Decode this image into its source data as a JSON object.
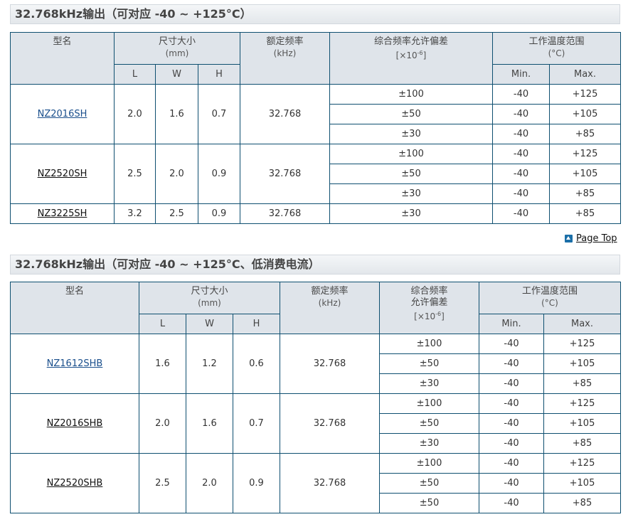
{
  "section1": {
    "title": "32.768kHz输出（可对应 -40 ~ +125°C）",
    "headers": {
      "model": "型名",
      "size": "尺寸大小",
      "size_unit": "(mm)",
      "L": "L",
      "W": "W",
      "H": "H",
      "freq": "额定频率",
      "freq_unit": "(kHz)",
      "tolerance": "综合频率允许偏差",
      "tol_unit_prefix": "[×10",
      "tol_unit_exp": "-6",
      "tol_unit_suffix": "]",
      "temp": "工作温度范围",
      "temp_unit": "(°C)",
      "min": "Min.",
      "max": "Max."
    },
    "groups": [
      {
        "model": "NZ2016SH",
        "linked": true,
        "L": "2.0",
        "W": "1.6",
        "H": "0.7",
        "freq": "32.768",
        "rows": [
          {
            "tol": "±100",
            "min": "-40",
            "max": "+125"
          },
          {
            "tol": "±50",
            "min": "-40",
            "max": "+105"
          },
          {
            "tol": "±30",
            "min": "-40",
            "max": "+85"
          }
        ]
      },
      {
        "model": "NZ2520SH",
        "linked": false,
        "L": "2.5",
        "W": "2.0",
        "H": "0.9",
        "freq": "32.768",
        "rows": [
          {
            "tol": "±100",
            "min": "-40",
            "max": "+125"
          },
          {
            "tol": "±50",
            "min": "-40",
            "max": "+105"
          },
          {
            "tol": "±30",
            "min": "-40",
            "max": "+85"
          }
        ]
      },
      {
        "model": "NZ3225SH",
        "linked": false,
        "L": "3.2",
        "W": "2.5",
        "H": "0.9",
        "freq": "32.768",
        "rows": [
          {
            "tol": "±30",
            "min": "-40",
            "max": "+85"
          }
        ]
      }
    ]
  },
  "page_top": "Page Top",
  "section2": {
    "title": "32.768kHz输出（可对应 -40 ~ +125°C、低消费电流）",
    "headers": {
      "model": "型名",
      "size": "尺寸大小",
      "size_unit": "(mm)",
      "L": "L",
      "W": "W",
      "H": "H",
      "freq": "额定频率",
      "freq_unit": "(kHz)",
      "tolerance_line1": "综合频率",
      "tolerance_line2": "允许偏差",
      "tol_unit_prefix": "[×10",
      "tol_unit_exp": "-6",
      "tol_unit_suffix": "]",
      "temp": "工作温度范围",
      "temp_unit": "(°C)",
      "min": "Min.",
      "max": "Max."
    },
    "groups": [
      {
        "model": "NZ1612SHB",
        "linked": true,
        "L": "1.6",
        "W": "1.2",
        "H": "0.6",
        "freq": "32.768",
        "rows": [
          {
            "tol": "±100",
            "min": "-40",
            "max": "+125"
          },
          {
            "tol": "±50",
            "min": "-40",
            "max": "+105"
          },
          {
            "tol": "±30",
            "min": "-40",
            "max": "+85"
          }
        ]
      },
      {
        "model": "NZ2016SHB",
        "linked": false,
        "L": "2.0",
        "W": "1.6",
        "H": "0.7",
        "freq": "32.768",
        "rows": [
          {
            "tol": "±100",
            "min": "-40",
            "max": "+125"
          },
          {
            "tol": "±50",
            "min": "-40",
            "max": "+105"
          },
          {
            "tol": "±30",
            "min": "-40",
            "max": "+85"
          }
        ]
      },
      {
        "model": "NZ2520SHB",
        "linked": false,
        "L": "2.5",
        "W": "2.0",
        "H": "0.9",
        "freq": "32.768",
        "rows": [
          {
            "tol": "±100",
            "min": "-40",
            "max": "+125"
          },
          {
            "tol": "±50",
            "min": "-40",
            "max": "+105"
          },
          {
            "tol": "±50",
            "min": "-40",
            "max": "+85"
          }
        ]
      }
    ]
  }
}
